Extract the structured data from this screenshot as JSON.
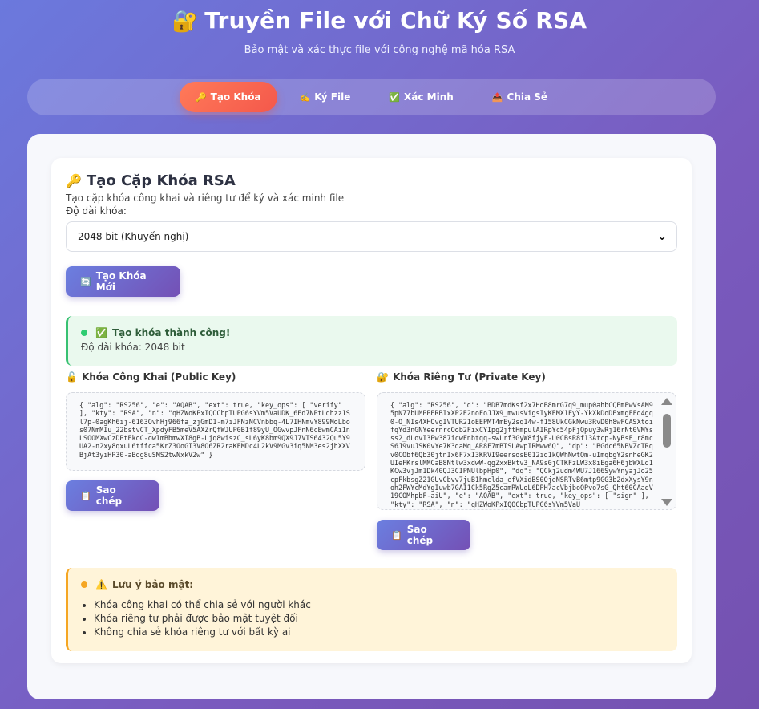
{
  "header": {
    "icon": "lock-key-icon",
    "icon_glyph": "🔐",
    "title": "Truyền File với Chữ Ký Số RSA",
    "subtitle": "Bảo mật và xác thực file với công nghệ mã hóa RSA"
  },
  "tabs": [
    {
      "label": "Tạo Khóa",
      "icon": "🔑",
      "active": true
    },
    {
      "label": "Ký File",
      "icon": "✍️",
      "active": false
    },
    {
      "label": "Xác Minh",
      "icon": "✅",
      "active": false
    },
    {
      "label": "Chia Sẻ",
      "icon": "📤",
      "active": false
    }
  ],
  "keygen": {
    "title_icon": "🔑",
    "title": "Tạo Cặp Khóa RSA",
    "description": "Tạo cặp khóa công khai và riêng tư để ký và xác minh file",
    "key_length_label": "Độ dài khóa:",
    "key_length_selected": "2048 bit (Khuyến nghị)",
    "generate_icon": "🔄",
    "generate_label": "Tạo Khóa Mới"
  },
  "success": {
    "icon": "✅",
    "title": "Tạo khóa thành công!",
    "detail": "Độ dài khóa: 2048 bit"
  },
  "public_key": {
    "icon": "🔓",
    "label": "Khóa Công Khai (Public Key)",
    "value": "{ \"alg\": \"RS256\", \"e\": \"AQAB\", \"ext\": true, \"key_ops\": [ \"verify\" ], \"kty\": \"RSA\", \"n\": \"qHZWoKPxIQOCbpTUPG6sYVm5VaUDK_6Ed7NPtLqhzz1Sl7p-0agKh6ij-6163OvhHj966fa_zjGmD1-m7iJFNzNCVnbbq-4L7IHNmvY899MoLbos07NmMIu_22bstvCT_XpdyFB5meV5AXZrQfWJUP0B1f89yU_OGwvpJFnN6cEwmCAi1nLSOOMXwCzDPtEkoC-owImBbmwXI8gB-Ljq8wiszC_sL6yK8bm9QX9J7VTS6432Qu5Y9UA2-n2xy8qxuL6tffca5KrZ3OoGI3V8O6ZR2raKEMDc4L2kV9MGv3iq5NM3es2jhXXVBjAt3yiHP30-aBdg8uSMS2twNxkV2w\" }",
    "copy_icon": "📋",
    "copy_label": "Sao chép"
  },
  "private_key": {
    "icon": "🔐",
    "label": "Khóa Riêng Tư (Private Key)",
    "value": "{ \"alg\": \"RS256\", \"d\": \"BDB7mdKsf2x7HoB8mrG7q9_mup0ahbCQEmEwVsAM95pN77bUMPPERBIxXP2E2noFoJJX9_mwusVigsIyKEMX1FyY-YkXkDoDExmgFFd4gq0-O_NIs4XHOvgIVTUR21oEEPMT4mEy2sq14w-f158UkCGkNwu3RvD0h8wFCASXtoifqYd3nGNYeernrcOob2FixCYIpg2jftHmpulAIRpYc54pFjQpuy3wRj16rNt0VMYsss2_dLovI3Pw387icwFnbtqq-swLrf3GyW8fjyF-U0CBsR8f13Atcp-NyBsF_r8mcS6J9vuJSK0vYe7K3qaMq_AR8F7mBTSLAwpIRMww6Q\", \"dp\": \"BGdc65NBVZcTRqv0CObf6Qb30jtnIx6F7xI3KRVI9eersosE012id1kQWhNwtQm-uImqbgY2snheGK2UIeFKrslMMCaB8Ntlw3xdwW-qgZxxBktv3_NA9s0jCTKFzLW3x8iEga6H6jbWXLq1KCw3vjJm1Dk40QJ3CIPNUlbpHp0\", \"dq\": \"QCkj2udm4WU7J166SywYnyajJo25cpFkbsgZ21GUvCbvv7juB1hmclda_efVXidBS0OjeNSRTvB6mtp9GG3b2dxXysY9noh2FWYcMdYgIuwb7GAI1Ck5RgZ5camRWUoL6DPH7acVbjboOPvo7sG_Qht60CAaqV19COMhpbF-aiU\", \"e\": \"AQAB\", \"ext\": true, \"key_ops\": [ \"sign\" ], \"kty\": \"RSA\", \"n\": \"qHZWoKPxIQOCbpTUPG6sYVm5VaU",
    "copy_icon": "📋",
    "copy_label": "Sao chép"
  },
  "security_note": {
    "icon": "⚠️",
    "title": "Lưu ý bảo mật:",
    "items": [
      "Khóa công khai có thể chia sẻ với người khác",
      "Khóa riêng tư phải được bảo mật tuyệt đối",
      "Không chia sẻ khóa riêng tư với bất kỳ ai"
    ]
  }
}
